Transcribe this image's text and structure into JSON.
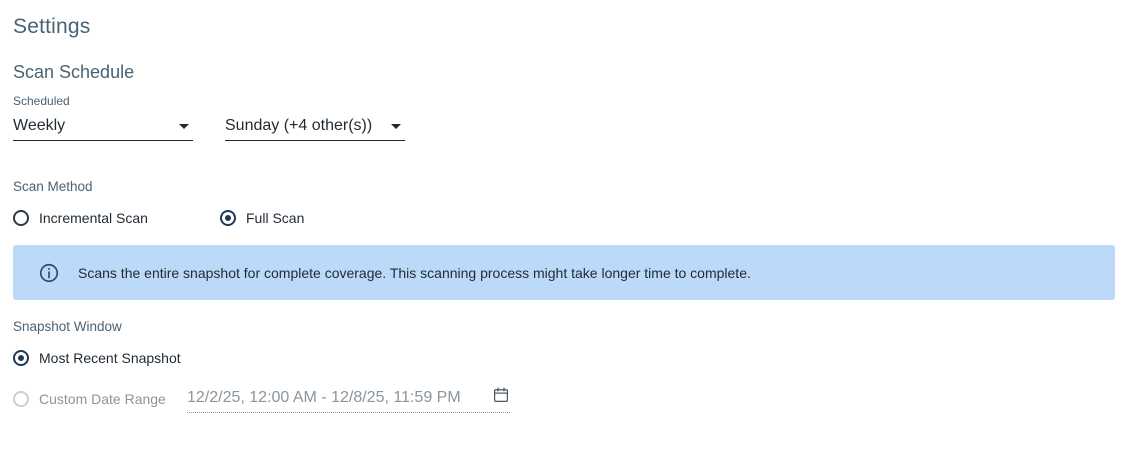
{
  "header": {
    "title": "Settings"
  },
  "scan_schedule": {
    "title": "Scan Schedule",
    "frequency": {
      "label": "Scheduled",
      "value": "Weekly"
    },
    "days": {
      "value": "Sunday (+4 other(s))"
    }
  },
  "scan_method": {
    "label": "Scan Method",
    "options": [
      {
        "label": "Incremental Scan",
        "checked": false
      },
      {
        "label": "Full Scan",
        "checked": true
      }
    ],
    "info": "Scans the entire snapshot for complete coverage. This scanning process might take longer time to complete."
  },
  "snapshot_window": {
    "label": "Snapshot Window",
    "options": [
      {
        "label": "Most Recent Snapshot",
        "checked": true
      },
      {
        "label": "Custom Date Range",
        "checked": false,
        "disabled": true
      }
    ],
    "date_range": "12/2/25, 12:00 AM - 12/8/25, 11:59 PM"
  },
  "icons": {
    "info": "info-icon",
    "calendar": "calendar-icon",
    "dropdown": "caret-down-icon"
  },
  "colors": {
    "banner_bg": "#bcd9fa",
    "heading": "#4a6272",
    "radio_checked": "#1e3a56",
    "disabled_text": "#8a959d"
  }
}
